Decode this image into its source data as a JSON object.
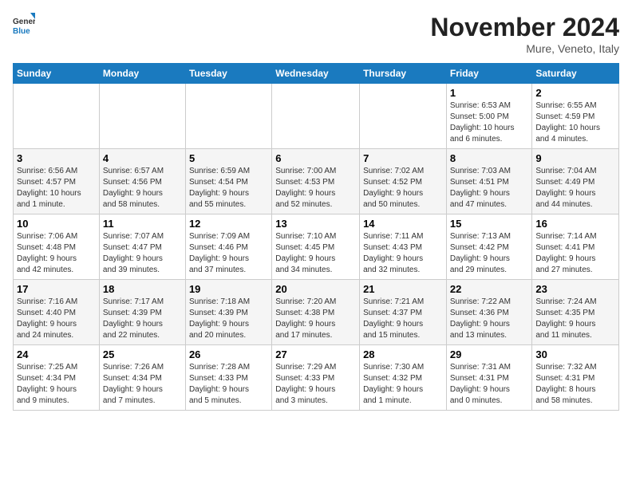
{
  "logo": {
    "line1": "General",
    "line2": "Blue"
  },
  "title": "November 2024",
  "subtitle": "Mure, Veneto, Italy",
  "days_header": [
    "Sunday",
    "Monday",
    "Tuesday",
    "Wednesday",
    "Thursday",
    "Friday",
    "Saturday"
  ],
  "weeks": [
    [
      {
        "day": "",
        "info": ""
      },
      {
        "day": "",
        "info": ""
      },
      {
        "day": "",
        "info": ""
      },
      {
        "day": "",
        "info": ""
      },
      {
        "day": "",
        "info": ""
      },
      {
        "day": "1",
        "info": "Sunrise: 6:53 AM\nSunset: 5:00 PM\nDaylight: 10 hours\nand 6 minutes."
      },
      {
        "day": "2",
        "info": "Sunrise: 6:55 AM\nSunset: 4:59 PM\nDaylight: 10 hours\nand 4 minutes."
      }
    ],
    [
      {
        "day": "3",
        "info": "Sunrise: 6:56 AM\nSunset: 4:57 PM\nDaylight: 10 hours\nand 1 minute."
      },
      {
        "day": "4",
        "info": "Sunrise: 6:57 AM\nSunset: 4:56 PM\nDaylight: 9 hours\nand 58 minutes."
      },
      {
        "day": "5",
        "info": "Sunrise: 6:59 AM\nSunset: 4:54 PM\nDaylight: 9 hours\nand 55 minutes."
      },
      {
        "day": "6",
        "info": "Sunrise: 7:00 AM\nSunset: 4:53 PM\nDaylight: 9 hours\nand 52 minutes."
      },
      {
        "day": "7",
        "info": "Sunrise: 7:02 AM\nSunset: 4:52 PM\nDaylight: 9 hours\nand 50 minutes."
      },
      {
        "day": "8",
        "info": "Sunrise: 7:03 AM\nSunset: 4:51 PM\nDaylight: 9 hours\nand 47 minutes."
      },
      {
        "day": "9",
        "info": "Sunrise: 7:04 AM\nSunset: 4:49 PM\nDaylight: 9 hours\nand 44 minutes."
      }
    ],
    [
      {
        "day": "10",
        "info": "Sunrise: 7:06 AM\nSunset: 4:48 PM\nDaylight: 9 hours\nand 42 minutes."
      },
      {
        "day": "11",
        "info": "Sunrise: 7:07 AM\nSunset: 4:47 PM\nDaylight: 9 hours\nand 39 minutes."
      },
      {
        "day": "12",
        "info": "Sunrise: 7:09 AM\nSunset: 4:46 PM\nDaylight: 9 hours\nand 37 minutes."
      },
      {
        "day": "13",
        "info": "Sunrise: 7:10 AM\nSunset: 4:45 PM\nDaylight: 9 hours\nand 34 minutes."
      },
      {
        "day": "14",
        "info": "Sunrise: 7:11 AM\nSunset: 4:43 PM\nDaylight: 9 hours\nand 32 minutes."
      },
      {
        "day": "15",
        "info": "Sunrise: 7:13 AM\nSunset: 4:42 PM\nDaylight: 9 hours\nand 29 minutes."
      },
      {
        "day": "16",
        "info": "Sunrise: 7:14 AM\nSunset: 4:41 PM\nDaylight: 9 hours\nand 27 minutes."
      }
    ],
    [
      {
        "day": "17",
        "info": "Sunrise: 7:16 AM\nSunset: 4:40 PM\nDaylight: 9 hours\nand 24 minutes."
      },
      {
        "day": "18",
        "info": "Sunrise: 7:17 AM\nSunset: 4:39 PM\nDaylight: 9 hours\nand 22 minutes."
      },
      {
        "day": "19",
        "info": "Sunrise: 7:18 AM\nSunset: 4:39 PM\nDaylight: 9 hours\nand 20 minutes."
      },
      {
        "day": "20",
        "info": "Sunrise: 7:20 AM\nSunset: 4:38 PM\nDaylight: 9 hours\nand 17 minutes."
      },
      {
        "day": "21",
        "info": "Sunrise: 7:21 AM\nSunset: 4:37 PM\nDaylight: 9 hours\nand 15 minutes."
      },
      {
        "day": "22",
        "info": "Sunrise: 7:22 AM\nSunset: 4:36 PM\nDaylight: 9 hours\nand 13 minutes."
      },
      {
        "day": "23",
        "info": "Sunrise: 7:24 AM\nSunset: 4:35 PM\nDaylight: 9 hours\nand 11 minutes."
      }
    ],
    [
      {
        "day": "24",
        "info": "Sunrise: 7:25 AM\nSunset: 4:34 PM\nDaylight: 9 hours\nand 9 minutes."
      },
      {
        "day": "25",
        "info": "Sunrise: 7:26 AM\nSunset: 4:34 PM\nDaylight: 9 hours\nand 7 minutes."
      },
      {
        "day": "26",
        "info": "Sunrise: 7:28 AM\nSunset: 4:33 PM\nDaylight: 9 hours\nand 5 minutes."
      },
      {
        "day": "27",
        "info": "Sunrise: 7:29 AM\nSunset: 4:33 PM\nDaylight: 9 hours\nand 3 minutes."
      },
      {
        "day": "28",
        "info": "Sunrise: 7:30 AM\nSunset: 4:32 PM\nDaylight: 9 hours\nand 1 minute."
      },
      {
        "day": "29",
        "info": "Sunrise: 7:31 AM\nSunset: 4:31 PM\nDaylight: 9 hours\nand 0 minutes."
      },
      {
        "day": "30",
        "info": "Sunrise: 7:32 AM\nSunset: 4:31 PM\nDaylight: 8 hours\nand 58 minutes."
      }
    ]
  ]
}
